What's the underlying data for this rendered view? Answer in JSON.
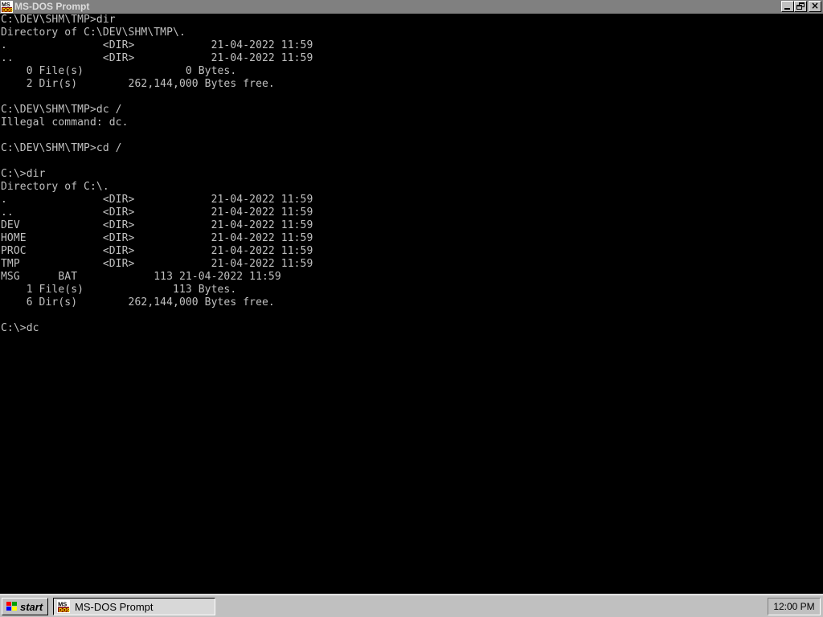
{
  "window": {
    "title": "MS-DOS Prompt",
    "icon": "ms-dos-icon",
    "controls": [
      "minimize",
      "restore",
      "close"
    ]
  },
  "console": {
    "lines": [
      "C:\\DEV\\SHM\\TMP>dir",
      "Directory of C:\\DEV\\SHM\\TMP\\.",
      ".               <DIR>            21-04-2022 11:59",
      "..              <DIR>            21-04-2022 11:59",
      "    0 File(s)                0 Bytes.",
      "    2 Dir(s)        262,144,000 Bytes free.",
      "",
      "C:\\DEV\\SHM\\TMP>dc /",
      "Illegal command: dc.",
      "",
      "C:\\DEV\\SHM\\TMP>cd /",
      "",
      "C:\\>dir",
      "Directory of C:\\.",
      ".               <DIR>            21-04-2022 11:59",
      "..              <DIR>            21-04-2022 11:59",
      "DEV             <DIR>            21-04-2022 11:59",
      "HOME            <DIR>            21-04-2022 11:59",
      "PROC            <DIR>            21-04-2022 11:59",
      "TMP             <DIR>            21-04-2022 11:59",
      "MSG      BAT            113 21-04-2022 11:59",
      "    1 File(s)              113 Bytes.",
      "    6 Dir(s)        262,144,000 Bytes free.",
      "",
      "C:\\>dc"
    ],
    "colors": {
      "background": "#000000",
      "foreground": "#c0c0c0"
    }
  },
  "taskbar": {
    "start_label": "start",
    "task_label": "MS-DOS Prompt",
    "clock": "12:00 PM"
  }
}
